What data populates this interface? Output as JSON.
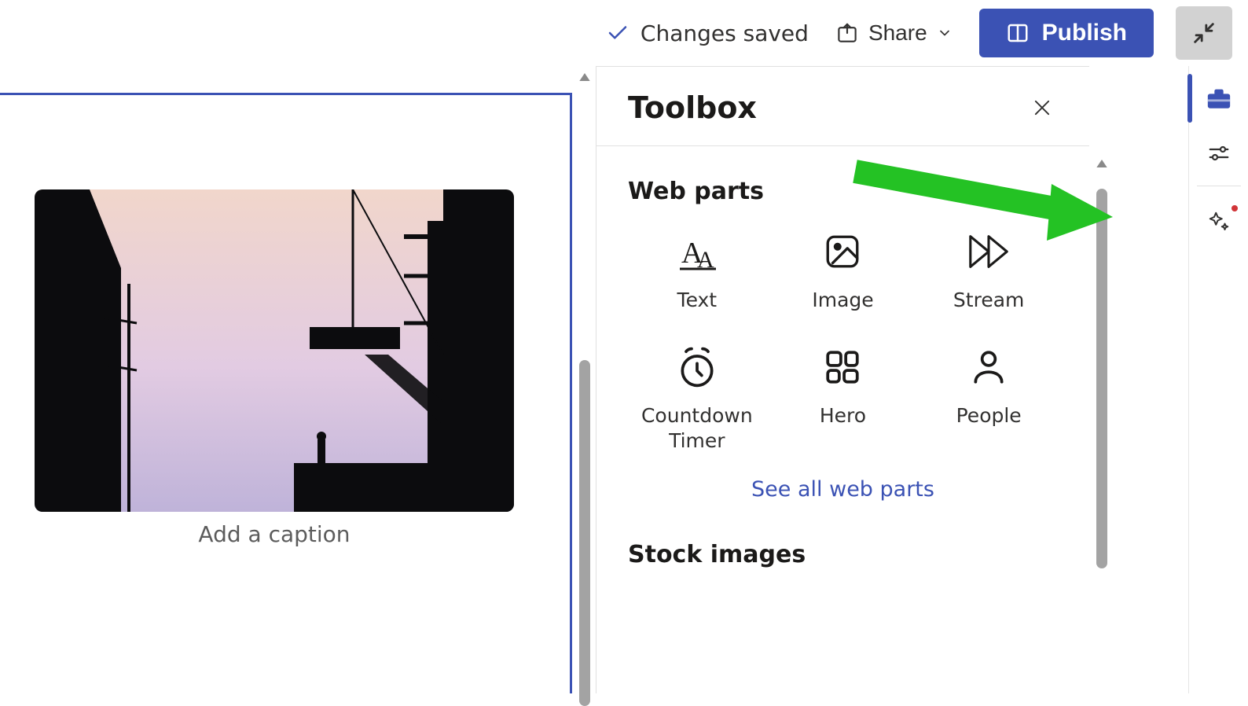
{
  "topbar": {
    "status_text": "Changes saved",
    "share_label": "Share",
    "publish_label": "Publish"
  },
  "canvas": {
    "caption_placeholder": "Add a caption"
  },
  "toolbox": {
    "title": "Toolbox",
    "section_web_parts": "Web parts",
    "see_all_label": "See all web parts",
    "section_stock_images": "Stock images",
    "items": [
      {
        "label": "Text"
      },
      {
        "label": "Image"
      },
      {
        "label": "Stream"
      },
      {
        "label": "Countdown Timer"
      },
      {
        "label": "Hero"
      },
      {
        "label": "People"
      }
    ]
  }
}
